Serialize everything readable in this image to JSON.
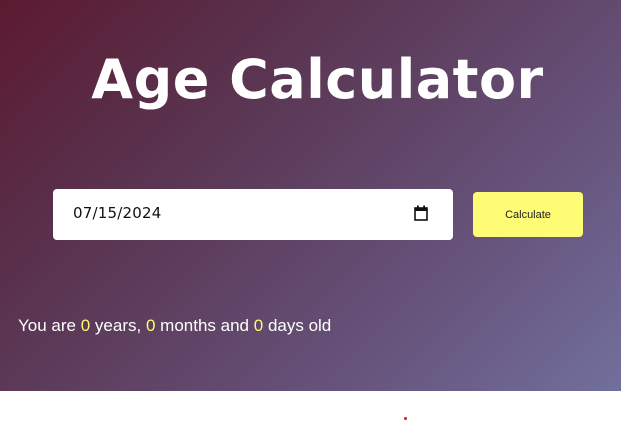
{
  "header": {
    "title": "Age Calculator"
  },
  "form": {
    "date_value": "07/15/2024",
    "calendar_icon": "calendar-icon",
    "calculate_label": "Calculate"
  },
  "result": {
    "prefix": "You are",
    "years": "0",
    "years_label": "years,",
    "months": "0",
    "months_label": "months and",
    "days": "0",
    "days_label": "days old"
  },
  "colors": {
    "accent": "#fdfc74",
    "gradient_start": "#5b1a30",
    "gradient_end": "#716f9c"
  }
}
